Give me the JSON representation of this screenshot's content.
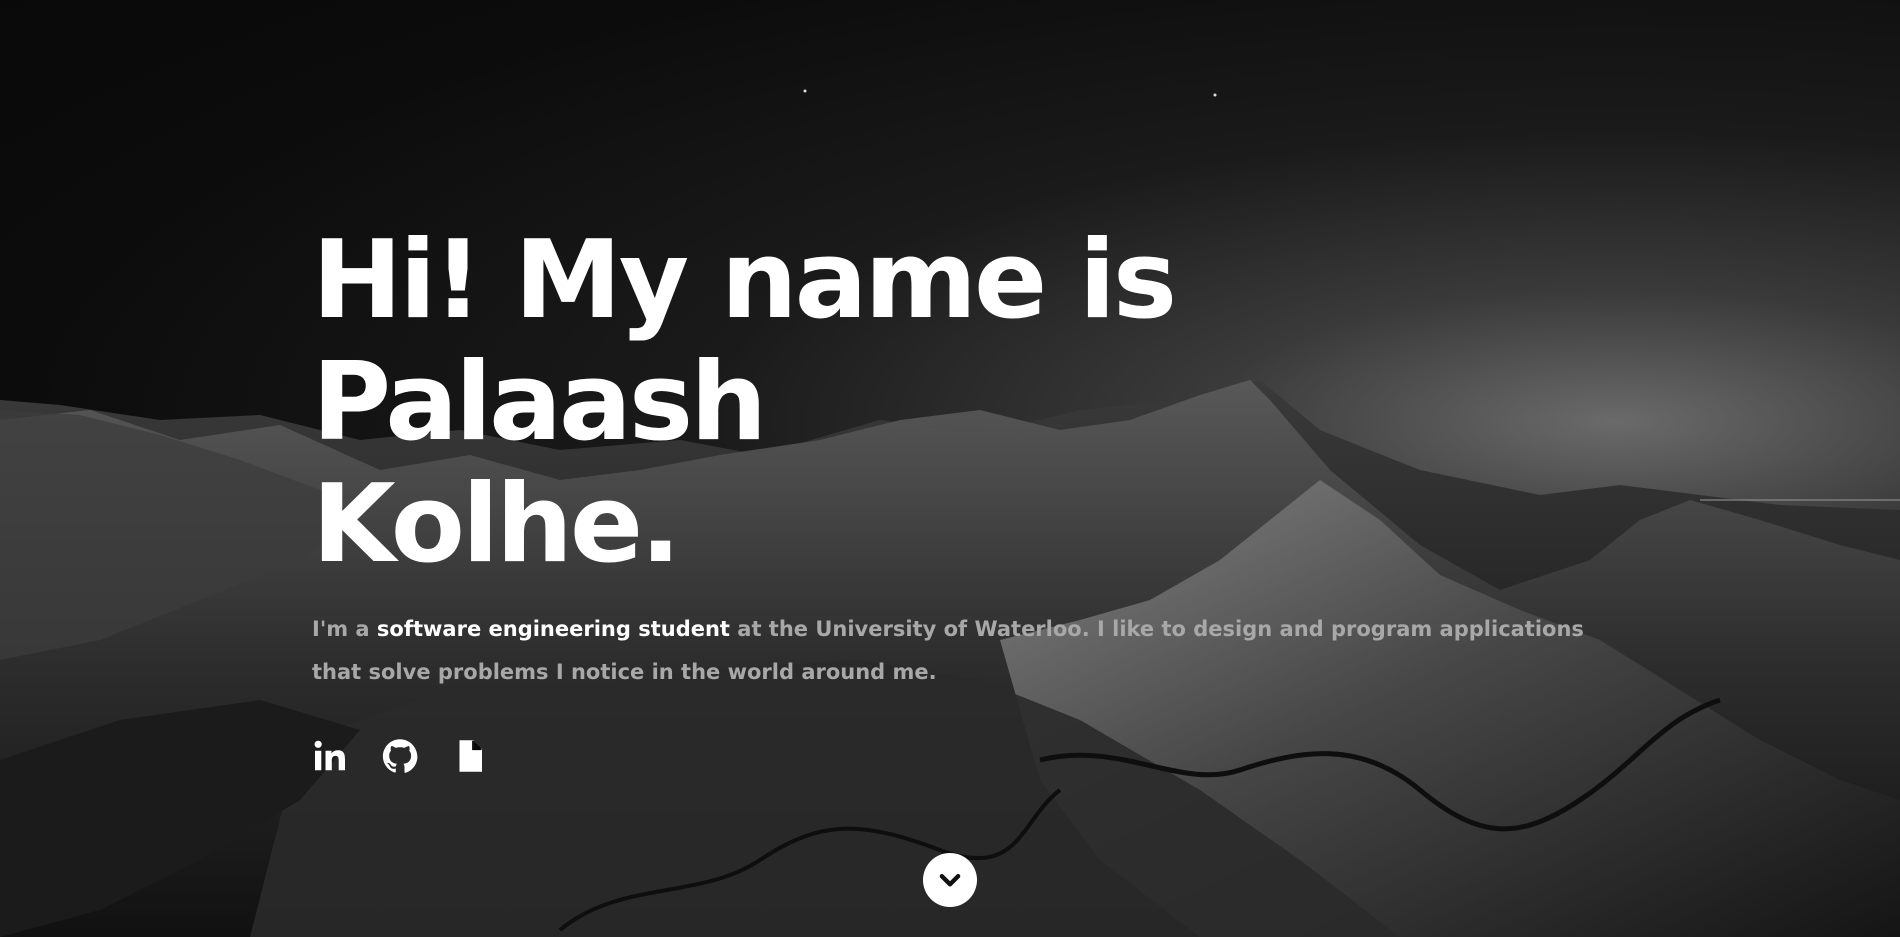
{
  "hero": {
    "heading_line1": "Hi! My name is Palaash",
    "heading_line2": "Kolhe.",
    "intro_prefix": "I'm a ",
    "intro_highlight": "software engineering student",
    "intro_suffix": " at the University of Waterloo. I like to design and program applications that solve problems I notice in the world around me."
  },
  "social_links": [
    {
      "icon": "linkedin-icon"
    },
    {
      "icon": "github-icon"
    },
    {
      "icon": "document-icon"
    }
  ],
  "scroll_button": {
    "icon": "chevron-down-icon"
  },
  "colors": {
    "background": "#0b0b0b",
    "heading": "#ffffff",
    "body_text": "#a8a8a8",
    "highlight": "#ffffff"
  }
}
